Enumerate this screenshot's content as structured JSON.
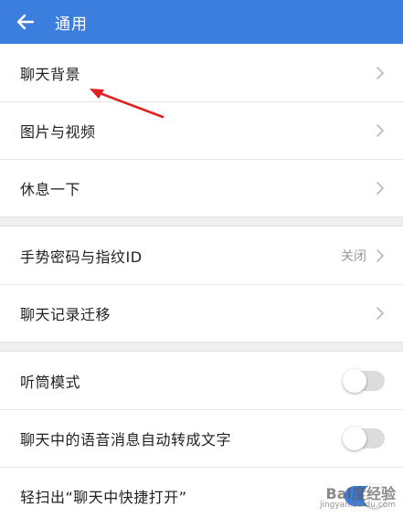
{
  "header": {
    "title": "通用",
    "back_icon": "arrow-left-icon"
  },
  "groups": [
    [
      {
        "label": "聊天背景",
        "type": "link"
      },
      {
        "label": "图片与视频",
        "type": "link"
      },
      {
        "label": "休息一下",
        "type": "link"
      }
    ],
    [
      {
        "label": "手势密码与指纹ID",
        "type": "link",
        "value": "关闭"
      },
      {
        "label": "聊天记录迁移",
        "type": "link"
      }
    ],
    [
      {
        "label": "听筒模式",
        "type": "toggle",
        "on": false
      },
      {
        "label": "聊天中的语音消息自动转成文字",
        "type": "toggle",
        "on": false
      },
      {
        "label": "轻扫出“聊天中快捷打开”",
        "type": "toggle",
        "on": true
      }
    ]
  ],
  "watermark": {
    "main": "Bai度经验",
    "sub": "jingyan.baidu.com"
  },
  "colors": {
    "header_bg": "#3c7ede",
    "toggle_on": "#3c7ede",
    "toggle_off": "#dcdcdc",
    "annotation_arrow": "#e02020"
  }
}
